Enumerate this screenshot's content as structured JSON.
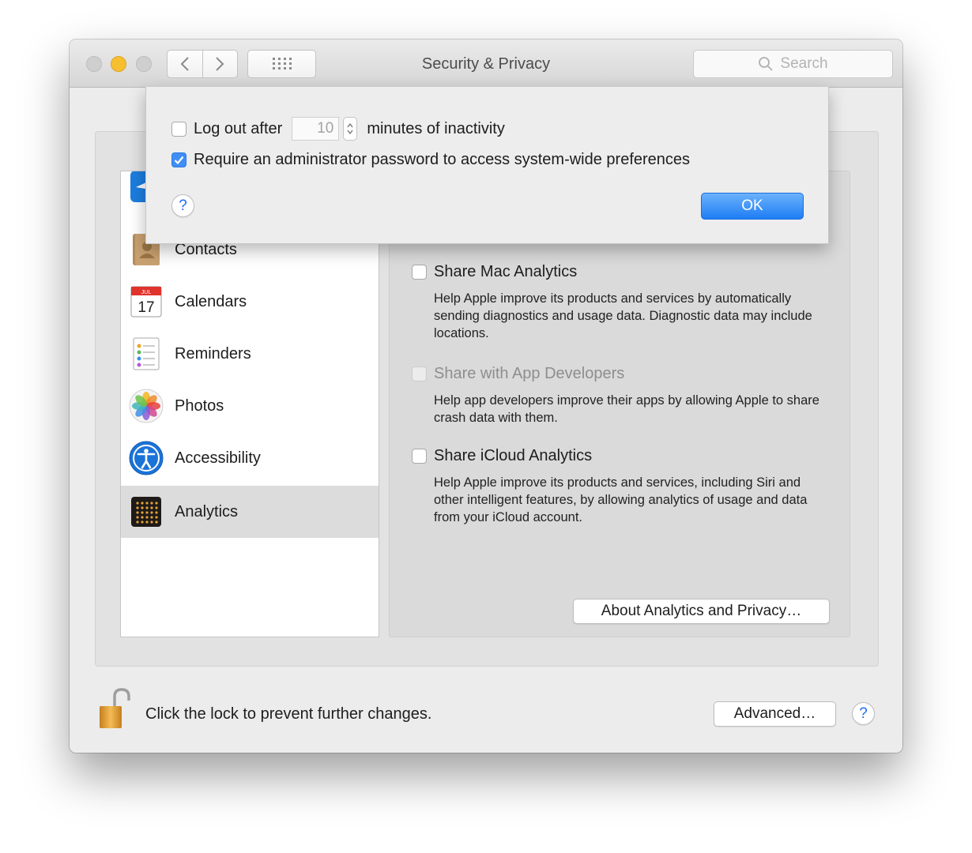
{
  "window": {
    "title": "Security & Privacy",
    "search_placeholder": "Search"
  },
  "sidebar": {
    "items": [
      {
        "label": "",
        "icon": "location-arrow-icon",
        "selected": false
      },
      {
        "label": "Contacts",
        "icon": "contacts-book-icon",
        "selected": false
      },
      {
        "label": "Calendars",
        "icon": "calendar-icon",
        "selected": false,
        "icon_text": {
          "month": "JUL",
          "day": "17"
        }
      },
      {
        "label": "Reminders",
        "icon": "reminders-list-icon",
        "selected": false
      },
      {
        "label": "Photos",
        "icon": "photos-flower-icon",
        "selected": false
      },
      {
        "label": "Accessibility",
        "icon": "accessibility-icon",
        "selected": false
      },
      {
        "label": "Analytics",
        "icon": "analytics-grid-icon",
        "selected": true
      }
    ]
  },
  "analytics": {
    "options": [
      {
        "label": "Share Mac Analytics",
        "checked": false,
        "enabled": true,
        "description": "Help Apple improve its products and services by automatically sending diagnostics and usage data. Diagnostic data may include locations."
      },
      {
        "label": "Share with App Developers",
        "checked": false,
        "enabled": false,
        "description": "Help app developers improve their apps by allowing Apple to share crash data with them."
      },
      {
        "label": "Share iCloud Analytics",
        "checked": false,
        "enabled": true,
        "description": "Help Apple improve its products and services, including Siri and other intelligent features, by allowing analytics of usage and data from your iCloud account."
      }
    ],
    "about_button": "About Analytics and Privacy…"
  },
  "footer": {
    "lock_text": "Click the lock to prevent further changes.",
    "advanced_button": "Advanced…",
    "help": "?"
  },
  "sheet": {
    "logout_label": "Log out after",
    "logout_checked": false,
    "minutes_value": "10",
    "minutes_suffix": "minutes of inactivity",
    "admin_label": "Require an administrator password to access system-wide preferences",
    "admin_checked": true,
    "help": "?",
    "ok_button": "OK"
  },
  "colors": {
    "accent": "#1e7df4",
    "minimize": "#f6bf30",
    "selection": "#dcdcdc"
  }
}
